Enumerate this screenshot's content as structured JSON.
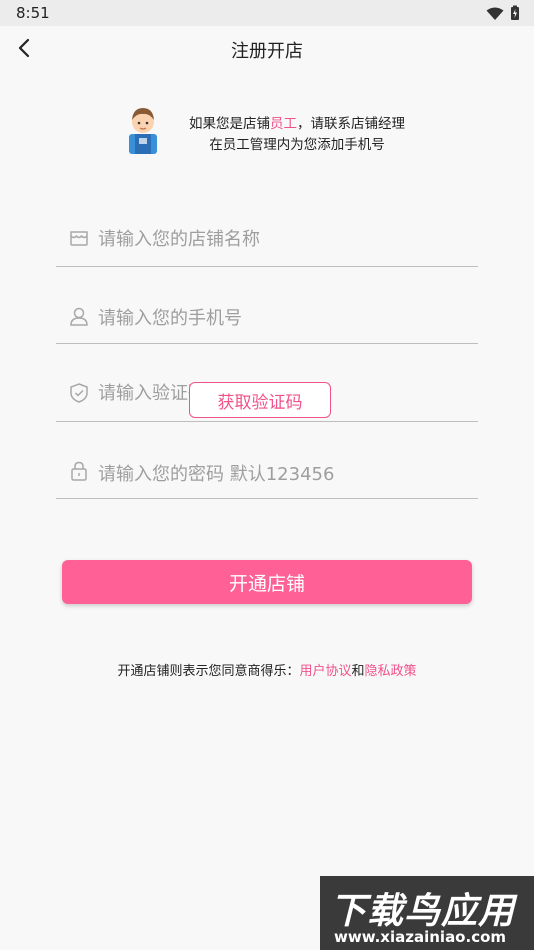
{
  "status_bar": {
    "time": "8:51"
  },
  "header": {
    "title": "注册开店"
  },
  "notice": {
    "line1_prefix": "如果您是店铺",
    "line1_highlight": "员工",
    "line1_suffix": "，请联系店铺经理",
    "line2": "在员工管理内为您添加手机号"
  },
  "form": {
    "store_name_placeholder": "请输入您的店铺名称",
    "phone_placeholder": "请输入您的手机号",
    "code_placeholder": "请输入验证码",
    "get_code_label": "获取验证码",
    "password_placeholder": "请输入您的密码 默认123456"
  },
  "submit_label": "开通店铺",
  "agreement": {
    "prefix": "开通店铺则表示您同意商得乐：",
    "user_agreement": "用户协议",
    "and": "和",
    "privacy_policy": "隐私政策"
  },
  "watermark": {
    "title": "下载鸟应用",
    "url": "www.xiazainiao.com"
  },
  "colors": {
    "accent": "#ff6196",
    "link": "#f0528a",
    "background": "#f8f8f8"
  }
}
